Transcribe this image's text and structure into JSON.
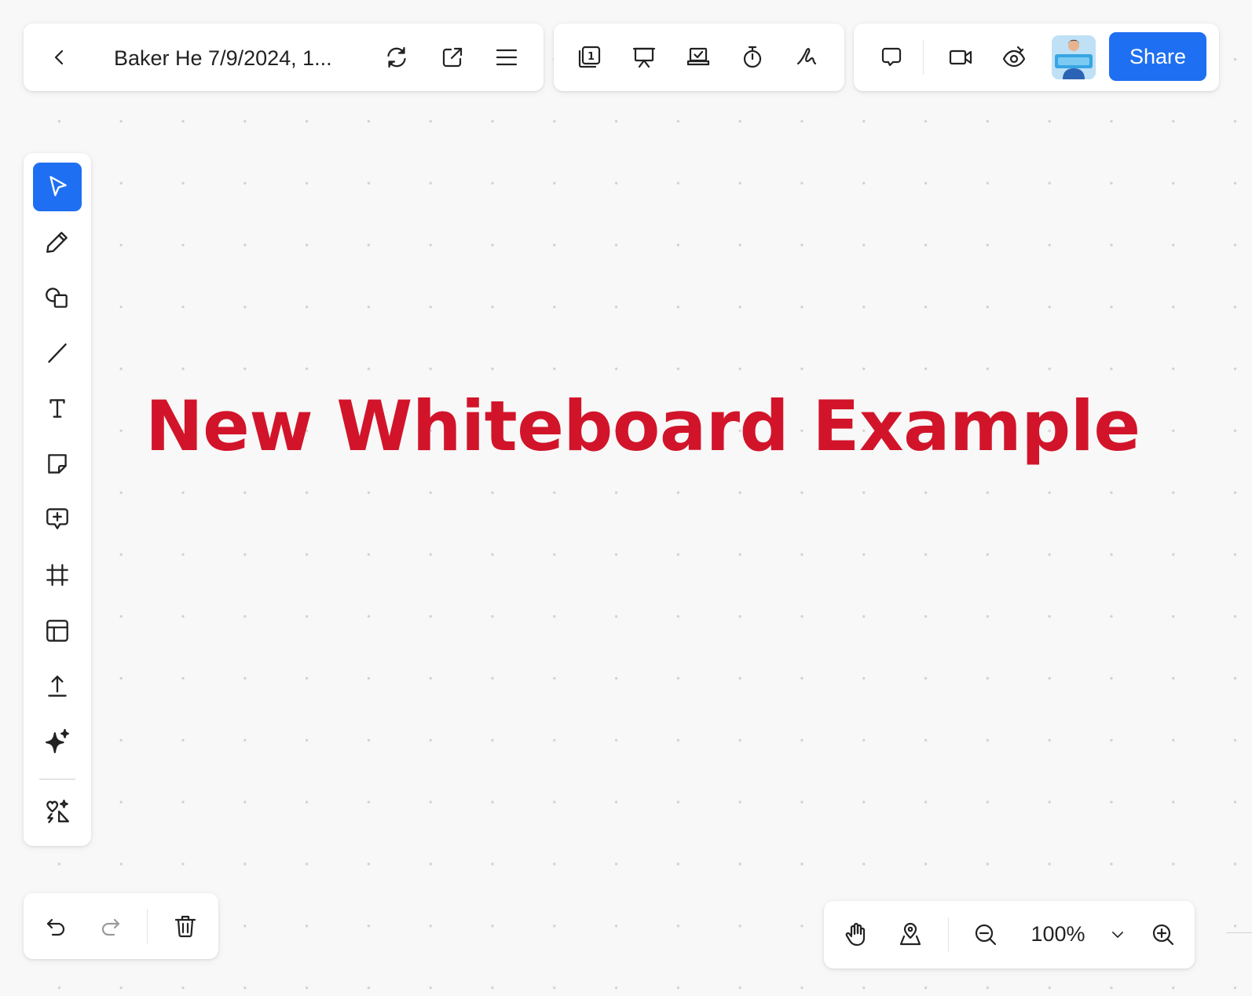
{
  "header": {
    "document_title": "Baker He 7/9/2024, 1...",
    "share_label": "Share",
    "icons": {
      "back": "chevron-left-icon",
      "sync": "sync-icon",
      "open_external": "open-external-icon",
      "menu": "hamburger-menu-icon",
      "pages": "pages-icon",
      "pages_count": "1",
      "present": "present-icon",
      "laptop_check": "laptop-check-icon",
      "timer": "timer-icon",
      "squiggle": "squiggle-icon",
      "chat": "chat-icon",
      "video": "video-icon",
      "eye": "eye-icon"
    }
  },
  "toolbar": {
    "tools": [
      {
        "name": "select-tool",
        "icon": "cursor-icon",
        "active": true
      },
      {
        "name": "pen-tool",
        "icon": "pencil-icon"
      },
      {
        "name": "shapes-tool",
        "icon": "shapes-icon"
      },
      {
        "name": "line-tool",
        "icon": "line-icon"
      },
      {
        "name": "text-tool",
        "icon": "text-icon"
      },
      {
        "name": "sticky-note-tool",
        "icon": "sticky-note-icon"
      },
      {
        "name": "comment-tool",
        "icon": "comment-add-icon"
      },
      {
        "name": "frame-tool",
        "icon": "frame-icon"
      },
      {
        "name": "template-tool",
        "icon": "template-icon"
      },
      {
        "name": "upload-tool",
        "icon": "upload-icon"
      },
      {
        "name": "ai-tool",
        "icon": "sparkle-icon"
      },
      {
        "name": "stickers-tool",
        "icon": "heart-shapes-icon"
      }
    ]
  },
  "canvas": {
    "text": "New Whiteboard Example",
    "text_color": "#d2142a"
  },
  "zoom": {
    "value": "100%"
  },
  "edit_controls": {
    "icons": [
      "undo-icon",
      "redo-icon",
      "trash-icon"
    ]
  },
  "colors": {
    "accent": "#1f6ff2",
    "canvas_bg": "#f8f8f8"
  }
}
